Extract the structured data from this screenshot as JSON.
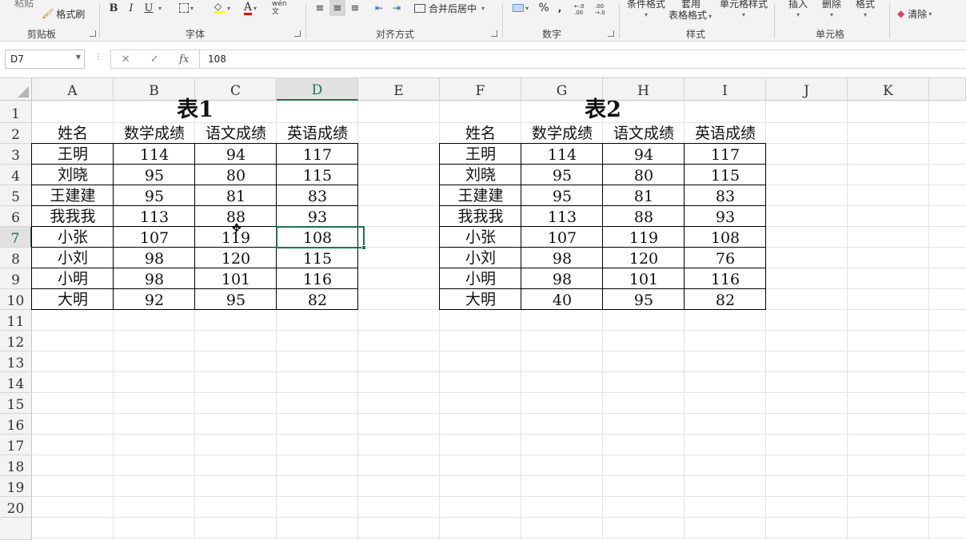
{
  "ribbon": {
    "paste_label": "粘贴",
    "format_painter_label": "格式刷",
    "clipboard_group": "剪贴板",
    "font_group": "字体",
    "bold": "B",
    "italic": "I",
    "underline": "U",
    "phonetic": "wén 文",
    "alignment_group": "对齐方式",
    "merge_center_label": "合并后居中",
    "number_group": "数字",
    "percent": "%",
    "comma": ",",
    "dec_increase": "←.0 .00",
    "dec_decrease": ".00 →.0",
    "conditional_format": "条件格式",
    "table_format_top": "套用",
    "table_format": "表格格式",
    "cell_styles": "单元格样式",
    "styles_group": "样式",
    "insert": "插入",
    "delete": "删除",
    "format": "格式",
    "cells_group": "单元格",
    "clear": "清除"
  },
  "formula_bar": {
    "name_box": "D7",
    "cancel": "✕",
    "enter": "✓",
    "fx": "fx",
    "value": "108"
  },
  "columns": [
    "A",
    "B",
    "C",
    "D",
    "E",
    "F",
    "G",
    "H",
    "I",
    "J",
    "K"
  ],
  "rows": [
    "1",
    "2",
    "3",
    "4",
    "5",
    "6",
    "7",
    "8",
    "9",
    "10",
    "11",
    "12",
    "13",
    "14",
    "15",
    "16",
    "17",
    "18",
    "19",
    "20"
  ],
  "selected": {
    "column": "D",
    "row": "7"
  },
  "table1": {
    "title": "表1",
    "headers": [
      "姓名",
      "数学成绩",
      "语文成绩",
      "英语成绩"
    ],
    "rows": [
      [
        "王明",
        "114",
        "94",
        "117"
      ],
      [
        "刘晓",
        "95",
        "80",
        "115"
      ],
      [
        "王建建",
        "95",
        "81",
        "83"
      ],
      [
        "我我我",
        "113",
        "88",
        "93"
      ],
      [
        "小张",
        "107",
        "119",
        "108"
      ],
      [
        "小刘",
        "98",
        "120",
        "115"
      ],
      [
        "小明",
        "98",
        "101",
        "116"
      ],
      [
        "大明",
        "92",
        "95",
        "82"
      ]
    ]
  },
  "table2": {
    "title": "表2",
    "headers": [
      "姓名",
      "数学成绩",
      "语文成绩",
      "英语成绩"
    ],
    "rows": [
      [
        "王明",
        "114",
        "94",
        "117"
      ],
      [
        "刘晓",
        "95",
        "80",
        "115"
      ],
      [
        "王建建",
        "95",
        "81",
        "83"
      ],
      [
        "我我我",
        "113",
        "88",
        "93"
      ],
      [
        "小张",
        "107",
        "119",
        "108"
      ],
      [
        "小刘",
        "98",
        "120",
        "76"
      ],
      [
        "小明",
        "98",
        "101",
        "116"
      ],
      [
        "大明",
        "40",
        "95",
        "82"
      ]
    ]
  },
  "colors": {
    "accent": "#217346",
    "grid": "#e2e2e2",
    "header_bg": "#f3f3f3"
  }
}
